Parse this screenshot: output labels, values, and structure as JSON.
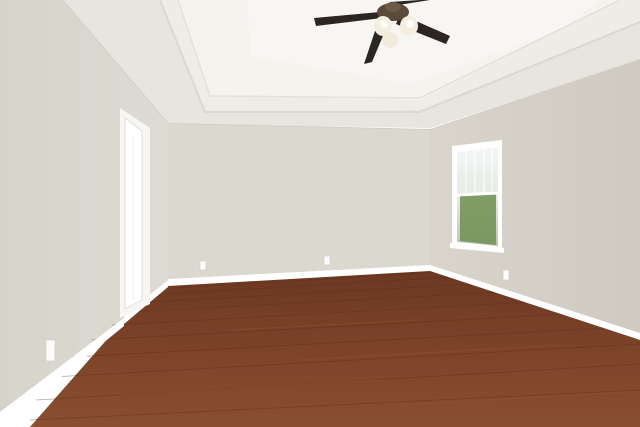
{
  "scene": {
    "subject": "empty-room",
    "elements": [
      "tray-ceiling",
      "ceiling-fan",
      "door",
      "window",
      "hardwood-floor",
      "baseboards",
      "wall-outlets"
    ],
    "colors": {
      "wall_left": "#dcd9d1",
      "wall_back": "#d9d6ce",
      "wall_right": "#d4d0c6",
      "ceiling": "#ece9e2",
      "tray": "#f4f2ec",
      "trim": "#ffffff",
      "floor_dark": "#5a2f1c",
      "floor_mid": "#7a4128",
      "floor_light": "#8e5233",
      "fan_blade": "#2b2622",
      "fan_glass": "#f3eee0",
      "window_green": "#6e8f52"
    }
  }
}
